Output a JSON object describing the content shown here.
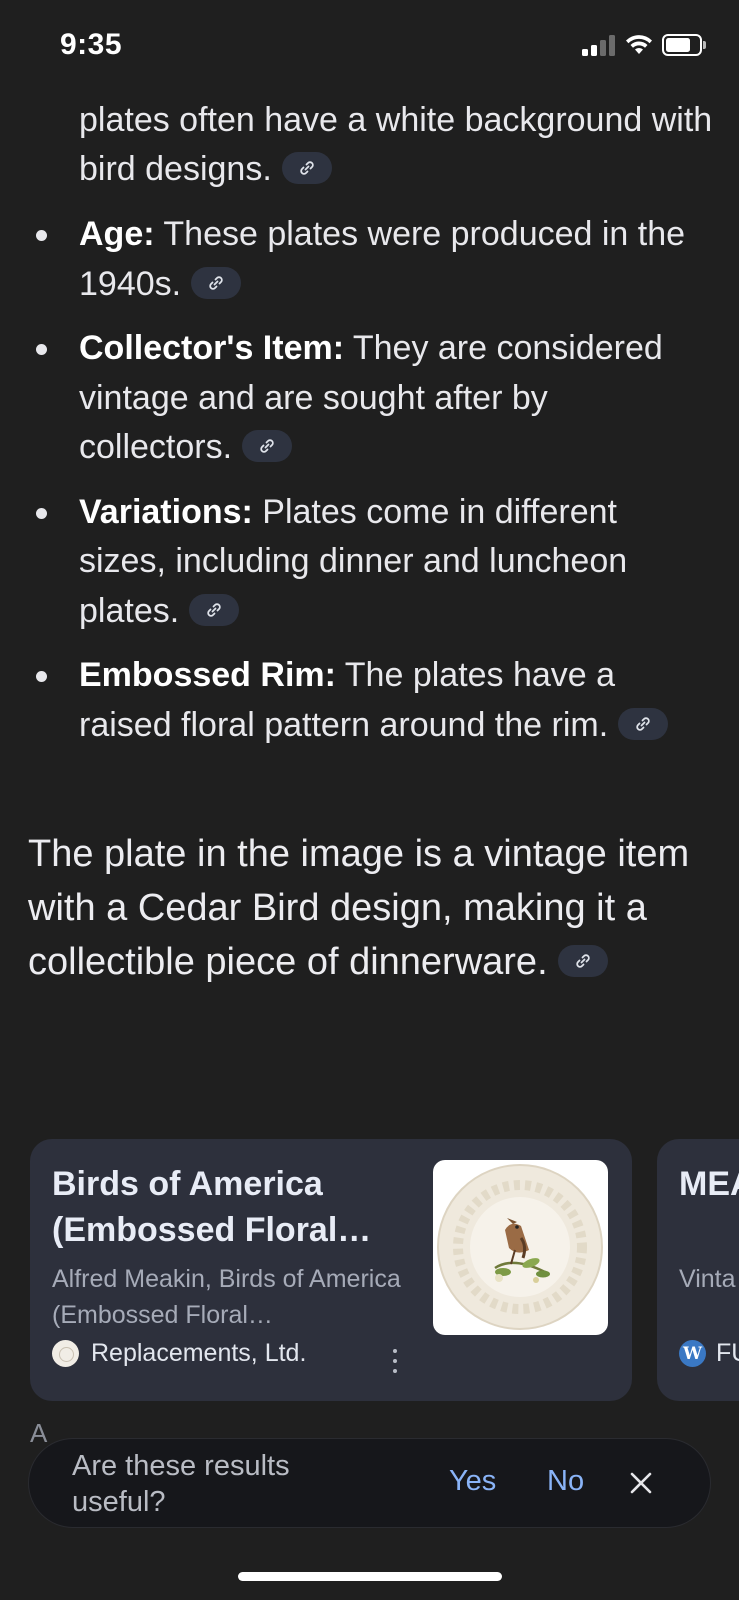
{
  "status_bar": {
    "time": "9:35"
  },
  "answer": {
    "continuation_text": "plates often have a white background with bird designs.",
    "bullets": [
      {
        "term": "Age:",
        "text": " These plates were produced in the 1940s."
      },
      {
        "term": "Collector's Item:",
        "text": " They are considered vintage and are sought after by collectors."
      },
      {
        "term": "Variations:",
        "text": " Plates come in different sizes, including dinner and luncheon plates."
      },
      {
        "term": "Embossed Rim:",
        "text": " The plates have a raised floral pattern around the rim."
      }
    ],
    "summary": "The plate in the image is a vintage item with a Cedar Bird design, making it a collectible piece of dinnerware."
  },
  "cards": [
    {
      "title": "Birds of America (Embossed Floral…",
      "subtitle": "Alfred Meakin, Birds of America (Embossed Floral…",
      "source": "Replacements, Ltd."
    },
    {
      "title": "MEA AMI",
      "subtitle": "Vinta of Ar",
      "source": "FU"
    }
  ],
  "feedback": {
    "partial_text": "A",
    "question": "Are these results useful?",
    "yes_label": "Yes",
    "no_label": "No"
  },
  "colors": {
    "background": "#1f1f1f",
    "card": "#2d303c",
    "chip": "#2e3340",
    "link_accent": "#8ab4f8"
  },
  "icons": [
    "signal-icon",
    "wifi-icon",
    "battery-icon",
    "link-icon",
    "more-vert-icon",
    "close-icon",
    "wordpress-icon"
  ]
}
